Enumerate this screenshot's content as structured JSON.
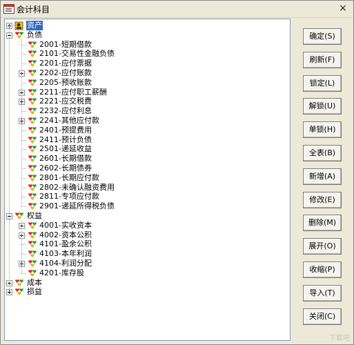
{
  "window": {
    "title": "会计科目",
    "close_glyph": "×"
  },
  "tree": [
    {
      "id": "n1",
      "depth": 0,
      "label": "资产",
      "expander": "plus",
      "selected": true,
      "icon": "card-icon"
    },
    {
      "id": "n2",
      "depth": 0,
      "label": "负债",
      "expander": "minus",
      "icon": "hearts-icon"
    },
    {
      "id": "n3",
      "depth": 1,
      "label": "2001-短期借款",
      "icon": "hearts-icon"
    },
    {
      "id": "n4",
      "depth": 1,
      "label": "2101-交易性金融负债",
      "icon": "hearts-icon"
    },
    {
      "id": "n5",
      "depth": 1,
      "label": "2201-应付票据",
      "icon": "hearts-icon"
    },
    {
      "id": "n6",
      "depth": 1,
      "label": "2202-应付账款",
      "expander": "plus",
      "icon": "hearts-icon"
    },
    {
      "id": "n7",
      "depth": 1,
      "label": "2205-预收账款",
      "icon": "hearts-icon"
    },
    {
      "id": "n8",
      "depth": 1,
      "label": "2211-应付职工薪酬",
      "expander": "plus",
      "icon": "hearts-icon"
    },
    {
      "id": "n9",
      "depth": 1,
      "label": "2221-应交税费",
      "expander": "plus",
      "icon": "hearts-icon"
    },
    {
      "id": "n10",
      "depth": 1,
      "label": "2232-应付利息",
      "icon": "hearts-icon"
    },
    {
      "id": "n11",
      "depth": 1,
      "label": "2241-其他应付款",
      "expander": "plus",
      "icon": "hearts-icon"
    },
    {
      "id": "n12",
      "depth": 1,
      "label": "2401-预提费用",
      "icon": "hearts-icon"
    },
    {
      "id": "n13",
      "depth": 1,
      "label": "2411-预计负债",
      "icon": "hearts-icon"
    },
    {
      "id": "n14",
      "depth": 1,
      "label": "2501-递延收益",
      "icon": "hearts-icon"
    },
    {
      "id": "n15",
      "depth": 1,
      "label": "2601-长期借款",
      "icon": "hearts-icon"
    },
    {
      "id": "n16",
      "depth": 1,
      "label": "2602-长期债券",
      "icon": "hearts-icon"
    },
    {
      "id": "n17",
      "depth": 1,
      "label": "2801-长期应付款",
      "icon": "hearts-icon"
    },
    {
      "id": "n18",
      "depth": 1,
      "label": "2802-未确认融资费用",
      "icon": "hearts-icon"
    },
    {
      "id": "n19",
      "depth": 1,
      "label": "2811-专项应付款",
      "icon": "hearts-icon"
    },
    {
      "id": "n20",
      "depth": 1,
      "label": "2901-递延所得税负债",
      "icon": "hearts-icon"
    },
    {
      "id": "n21",
      "depth": 0,
      "label": "权益",
      "expander": "minus",
      "icon": "hearts-icon"
    },
    {
      "id": "n22",
      "depth": 1,
      "label": "4001-实收资本",
      "expander": "plus",
      "icon": "hearts-icon"
    },
    {
      "id": "n23",
      "depth": 1,
      "label": "4002-资本公积",
      "expander": "plus",
      "icon": "hearts-icon"
    },
    {
      "id": "n24",
      "depth": 1,
      "label": "4101-盈余公积",
      "icon": "hearts-icon"
    },
    {
      "id": "n25",
      "depth": 1,
      "label": "4103-本年利润",
      "icon": "hearts-icon"
    },
    {
      "id": "n26",
      "depth": 1,
      "label": "4104-利润分配",
      "expander": "plus",
      "icon": "hearts-icon"
    },
    {
      "id": "n27",
      "depth": 1,
      "label": "4201-库存股",
      "icon": "hearts-icon"
    },
    {
      "id": "n28",
      "depth": 0,
      "label": "成本",
      "expander": "plus",
      "icon": "hearts-icon"
    },
    {
      "id": "n29",
      "depth": 0,
      "label": "损益",
      "expander": "plus",
      "icon": "hearts-icon"
    }
  ],
  "buttons": [
    {
      "id": "confirm",
      "label": "确定(S)"
    },
    {
      "id": "refresh",
      "label": "刷新(F)"
    },
    {
      "id": "lock",
      "label": "锁定(L)"
    },
    {
      "id": "unlock",
      "label": "解锁(U)"
    },
    {
      "id": "single-lock",
      "label": "单锁(H)"
    },
    {
      "id": "full-table",
      "label": "全表(B)"
    },
    {
      "id": "add",
      "label": "新增(A)"
    },
    {
      "id": "modify",
      "label": "修改(E)"
    },
    {
      "id": "delete",
      "label": "删除(M)"
    },
    {
      "id": "expand",
      "label": "展开(O)"
    },
    {
      "id": "collapse",
      "label": "收缩(P)"
    },
    {
      "id": "import",
      "label": "导入(T)"
    },
    {
      "id": "close",
      "label": "关闭(C)"
    }
  ],
  "watermark": "下载吧",
  "colors": {
    "selection": "#316ac5",
    "window_bg": "#ece9d8",
    "tree_border": "#7f9db9"
  }
}
